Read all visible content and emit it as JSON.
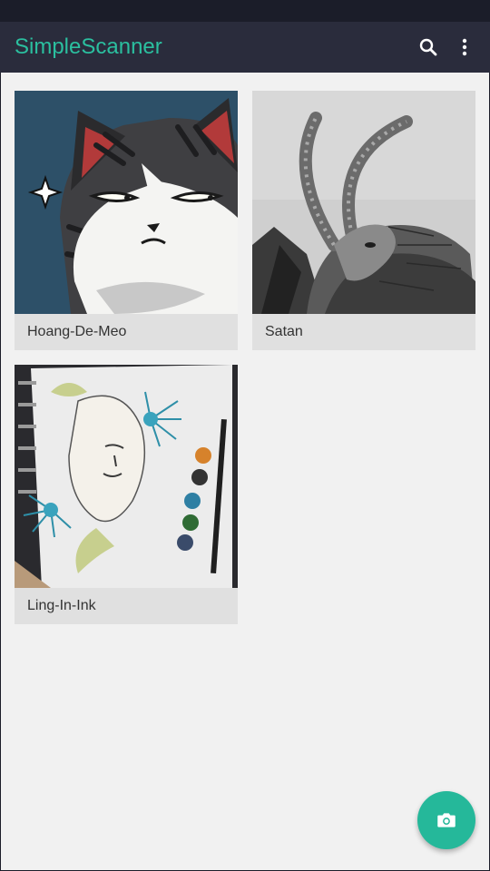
{
  "app": {
    "title": "SimpleScanner",
    "accent_color": "#2bbf9f",
    "toolbar_color": "#2a2c3c"
  },
  "toolbar": {
    "search_icon": "search-icon",
    "more_icon": "more-vert-icon"
  },
  "documents": [
    {
      "name": "Hoang-De-Meo",
      "thumbnail": "cartoon-cat-illustration"
    },
    {
      "name": "Satan",
      "thumbnail": "pencil-sketch-goat"
    },
    {
      "name": "Ling-In-Ink",
      "thumbnail": "ink-watercolor-flower-face"
    }
  ],
  "fab": {
    "icon": "camera-icon",
    "color": "#25b89a"
  }
}
